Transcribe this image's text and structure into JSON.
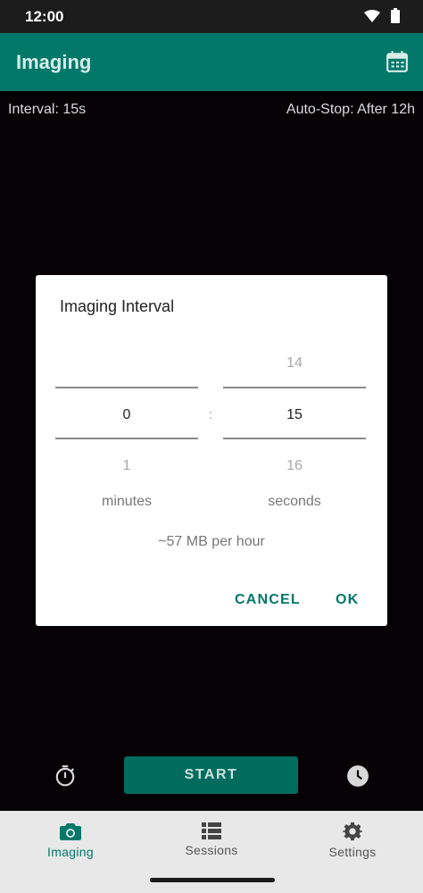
{
  "status_bar": {
    "time": "12:00"
  },
  "app_bar": {
    "title": "Imaging"
  },
  "info": {
    "interval": "Interval: 15s",
    "auto_stop": "Auto-Stop: After 12h"
  },
  "dialog": {
    "title": "Imaging Interval",
    "minutes": {
      "prev": "",
      "current": "0",
      "next": "1",
      "unit": "minutes"
    },
    "seconds": {
      "prev": "14",
      "current": "15",
      "next": "16",
      "unit": "seconds"
    },
    "separator": ":",
    "size_estimate": "~57 MB per hour",
    "cancel_label": "CANCEL",
    "ok_label": "OK"
  },
  "controls": {
    "start_label": "START"
  },
  "bottom_nav": {
    "items": [
      {
        "label": "Imaging",
        "icon": "camera-icon",
        "active": true
      },
      {
        "label": "Sessions",
        "icon": "list-icon",
        "active": false
      },
      {
        "label": "Settings",
        "icon": "gear-icon",
        "active": false
      }
    ]
  },
  "colors": {
    "primary": "#017869",
    "nav_bg": "#e8e8e8",
    "status_bg": "#1c1c1c"
  }
}
